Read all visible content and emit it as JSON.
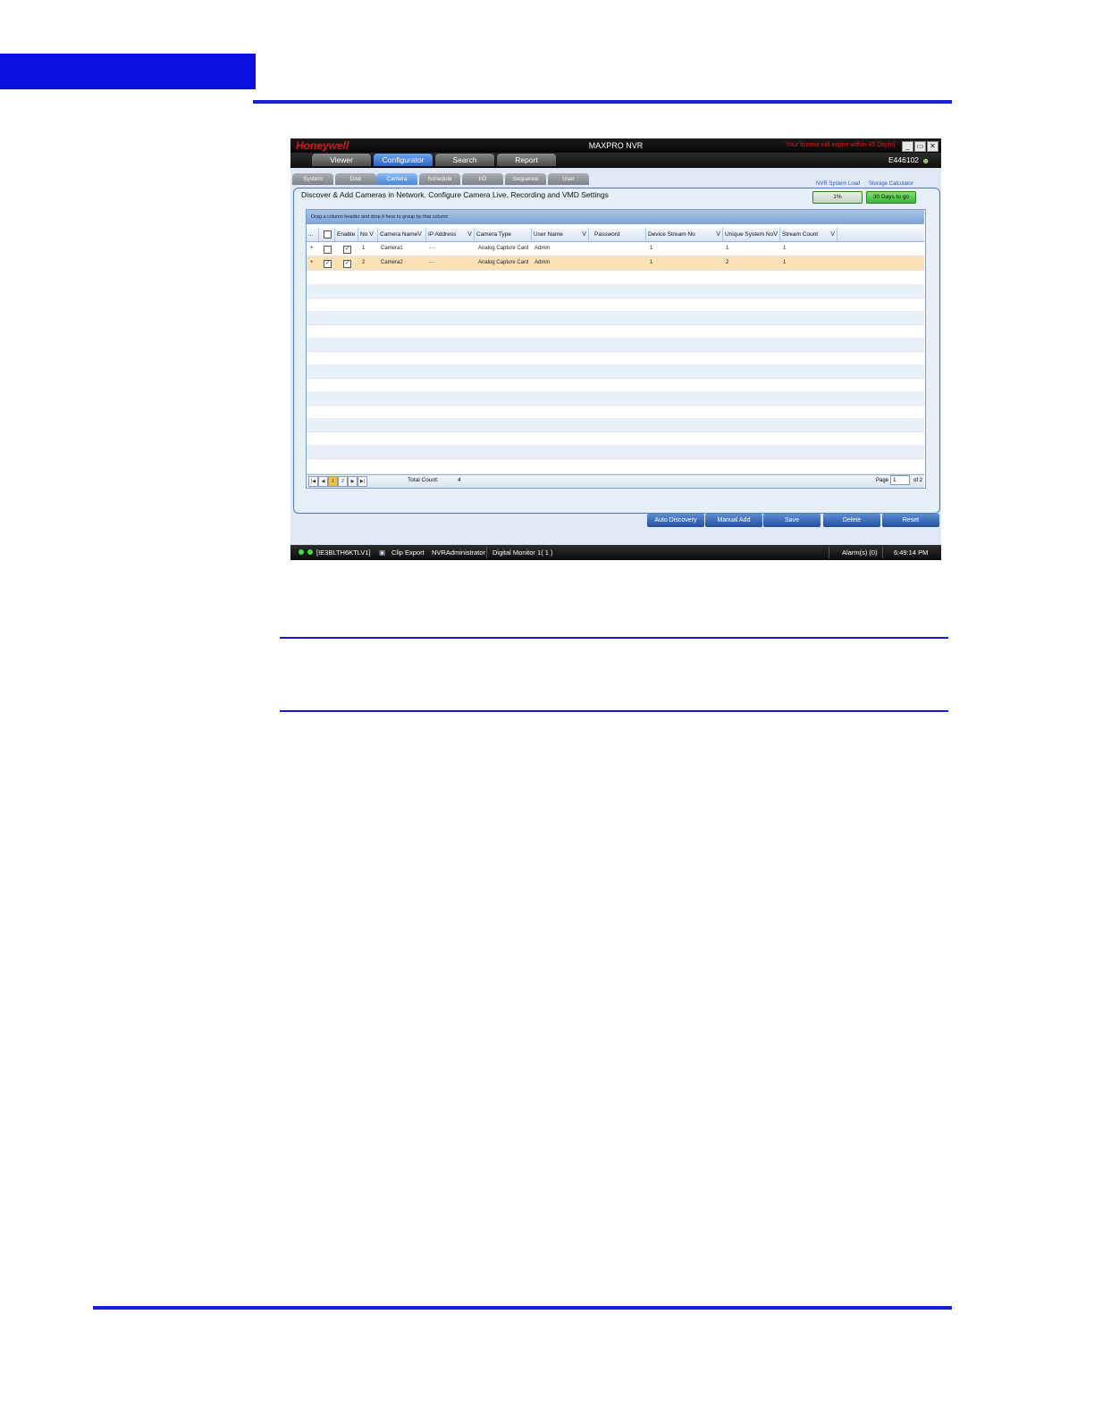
{
  "app": {
    "brand": "Honeywell",
    "title": "MAXPRO NVR",
    "license_notice": "Your license will expire within 45 Day(s)",
    "user_id": "E446102",
    "window_buttons": [
      "_",
      "▭",
      "✕"
    ]
  },
  "menu": {
    "tabs": [
      {
        "label": "Viewer"
      },
      {
        "label": "Configurator",
        "active": true
      },
      {
        "label": "Search"
      },
      {
        "label": "Report"
      }
    ]
  },
  "subtabs": [
    {
      "label": "System"
    },
    {
      "label": "Disk"
    },
    {
      "label": "Camera",
      "active": true
    },
    {
      "label": "Schedule"
    },
    {
      "label": "I/O"
    },
    {
      "label": "Sequence"
    },
    {
      "label": "User"
    }
  ],
  "panel": {
    "title": "Discover & Add Cameras in Network. Configure Camera Live, Recording and VMD Settings",
    "nvr_load_label": "NVR System Load",
    "nvr_load_value": "1%",
    "storage_label": "Storage Calculator",
    "storage_value": "30 Days to go"
  },
  "grid": {
    "group_hint": "Drag a column header and drop it here to group by that column",
    "columns": [
      "...",
      "",
      "Enable",
      "No",
      "Camera Name",
      "IP Address",
      "Camera Type",
      "User Name",
      "Password",
      "Device Stream No",
      "Unique System No",
      "Stream Count"
    ],
    "rows": [
      {
        "expander": "+",
        "selected": false,
        "enable": true,
        "no": "1",
        "camera_name": "Camera1",
        "ip": "- -",
        "camera_type": "Analog Capture Card",
        "user": "Admin",
        "password": "",
        "device_stream_no": "1",
        "unique_system_no": "1",
        "stream_count": "1"
      },
      {
        "expander": "+",
        "selected": true,
        "enable": true,
        "no": "2",
        "camera_name": "Camera2",
        "ip": "- -",
        "camera_type": "Analog Capture Card",
        "user": "Admin",
        "password": "",
        "device_stream_no": "1",
        "unique_system_no": "2",
        "stream_count": "1"
      }
    ],
    "pager": {
      "pages": [
        "1",
        "2"
      ],
      "current_page": "1",
      "total_count_label": "Total Count:",
      "total_count": "4",
      "page_label": "Page",
      "page_input": "1",
      "page_of": "of 2"
    }
  },
  "actions": {
    "auto_discovery": "Auto Discovery",
    "manual_add": "Manual Add",
    "save": "Save",
    "delete": "Delete",
    "reset": "Reset"
  },
  "status": {
    "host": "[IE3BLTH6KTLV1]",
    "clip_export": "Clip Export",
    "user": "NVRAdministrator",
    "monitor": "Digital Monitor 1( 1 )",
    "alarms": "Alarm(s) (0)",
    "time": "6:49:14 PM"
  },
  "colors": {
    "page_accent": "#1420d8",
    "brand_red": "#d31a1a",
    "selected_row": "#fbe2b6",
    "active_tab": "#2d62c7"
  }
}
